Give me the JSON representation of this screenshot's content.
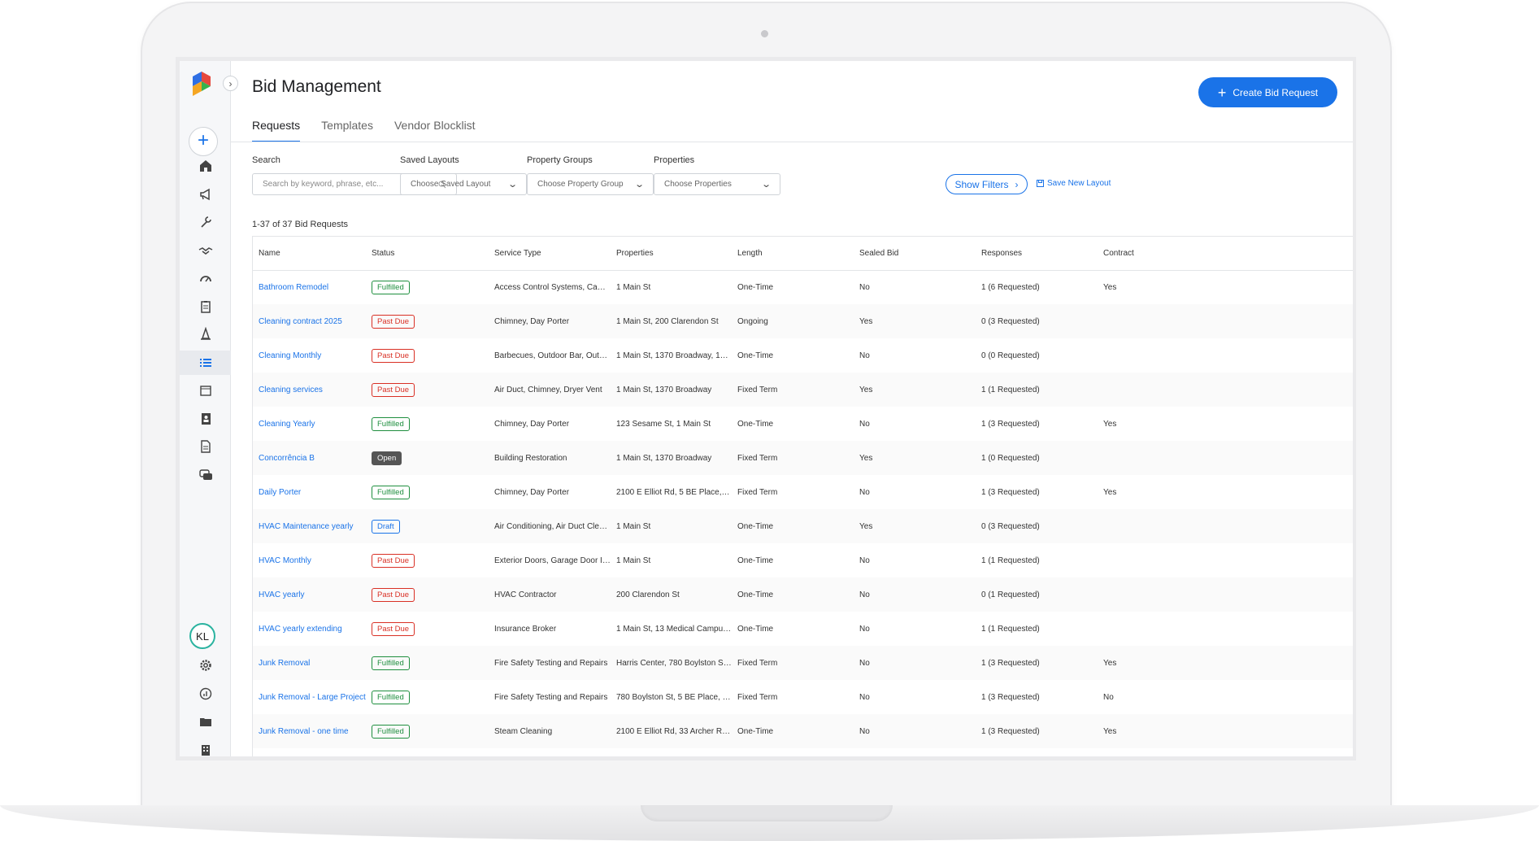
{
  "app": {
    "title": "Bid Management",
    "create_button": "Create Bid Request"
  },
  "tabs": [
    {
      "label": "Requests",
      "active": true
    },
    {
      "label": "Templates",
      "active": false
    },
    {
      "label": "Vendor Blocklist",
      "active": false
    }
  ],
  "sidebar": {
    "user_initials": "KL",
    "items": [
      {
        "icon": "home-icon"
      },
      {
        "icon": "megaphone-icon"
      },
      {
        "icon": "wrench-icon"
      },
      {
        "icon": "handshake-icon"
      },
      {
        "icon": "gauge-icon"
      },
      {
        "icon": "clipboard-icon"
      },
      {
        "icon": "cone-icon"
      },
      {
        "icon": "list-icon",
        "active": true
      },
      {
        "icon": "calendar-icon"
      },
      {
        "icon": "contacts-icon"
      },
      {
        "icon": "document-icon"
      },
      {
        "icon": "chat-icon"
      }
    ],
    "bottom_items": [
      {
        "icon": "gear-icon"
      },
      {
        "icon": "analytics-icon"
      },
      {
        "icon": "folder-icon"
      },
      {
        "icon": "building-icon"
      }
    ]
  },
  "filters": {
    "search_label": "Search",
    "search_placeholder": "Search by keyword, phrase, etc...",
    "saved_layouts_label": "Saved Layouts",
    "saved_layouts_value": "Choose Saved Layout",
    "property_groups_label": "Property Groups",
    "property_groups_value": "Choose Property Group",
    "properties_label": "Properties",
    "properties_value": "Choose Properties",
    "show_filters": "Show Filters",
    "save_new_layout": "Save New Layout"
  },
  "results_count": "1-37 of 37 Bid Requests",
  "table": {
    "columns": [
      "Name",
      "Status",
      "Service Type",
      "Properties",
      "Length",
      "Sealed Bid",
      "Responses",
      "Contract"
    ],
    "rows": [
      {
        "name": "Bathroom Remodel",
        "status": "Fulfilled",
        "service": "Access Control Systems, Cameras / ...",
        "properties": "1 Main St",
        "length": "One-Time",
        "sealed": "No",
        "responses": "1 (6 Requested)",
        "contract": "Yes"
      },
      {
        "name": "Cleaning contract 2025",
        "status": "Past Due",
        "service": "Chimney, Day Porter",
        "properties": "1 Main St, 200 Clarendon St",
        "length": "Ongoing",
        "sealed": "Yes",
        "responses": "0 (3 Requested)",
        "contract": ""
      },
      {
        "name": "Cleaning Monthly",
        "status": "Past Due",
        "service": "Barbecues, Outdoor Bar, Outdoor Fir...",
        "properties": "1 Main St, 1370 Broadway, 13 Medic...",
        "length": "One-Time",
        "sealed": "No",
        "responses": "0 (0 Requested)",
        "contract": ""
      },
      {
        "name": "Cleaning services",
        "status": "Past Due",
        "service": "Air Duct, Chimney, Dryer Vent",
        "properties": "1 Main St, 1370 Broadway",
        "length": "Fixed Term",
        "sealed": "Yes",
        "responses": "1 (1 Requested)",
        "contract": ""
      },
      {
        "name": "Cleaning Yearly",
        "status": "Fulfilled",
        "service": "Chimney, Day Porter",
        "properties": "123 Sesame St, 1 Main St",
        "length": "One-Time",
        "sealed": "No",
        "responses": "1 (3 Requested)",
        "contract": "Yes"
      },
      {
        "name": "Concorrência B",
        "status": "Open",
        "service": "Building Restoration",
        "properties": "1 Main St, 1370 Broadway",
        "length": "Fixed Term",
        "sealed": "Yes",
        "responses": "1 (0 Requested)",
        "contract": ""
      },
      {
        "name": "Daily Porter",
        "status": "Fulfilled",
        "service": "Chimney, Day Porter",
        "properties": "2100 E Elliot Rd, 5 BE Place, 1 Main ...",
        "length": "Fixed Term",
        "sealed": "No",
        "responses": "1 (3 Requested)",
        "contract": "Yes"
      },
      {
        "name": "HVAC Maintenance yearly",
        "status": "Draft",
        "service": "Air Conditioning, Air Duct Cleaning, ...",
        "properties": "1 Main St",
        "length": "One-Time",
        "sealed": "Yes",
        "responses": "0 (3 Requested)",
        "contract": ""
      },
      {
        "name": "HVAC Monthly",
        "status": "Past Due",
        "service": "Exterior Doors, Garage Door Installat...",
        "properties": "1 Main St",
        "length": "One-Time",
        "sealed": "No",
        "responses": "1 (1 Requested)",
        "contract": ""
      },
      {
        "name": "HVAC yearly",
        "status": "Past Due",
        "service": "HVAC Contractor",
        "properties": "200 Clarendon St",
        "length": "One-Time",
        "sealed": "No",
        "responses": "0 (1 Requested)",
        "contract": ""
      },
      {
        "name": "HVAC yearly extending",
        "status": "Past Due",
        "service": "Insurance Broker",
        "properties": "1 Main St, 13 Medical Campus Drive",
        "length": "One-Time",
        "sealed": "No",
        "responses": "1 (1 Requested)",
        "contract": ""
      },
      {
        "name": "Junk Removal",
        "status": "Fulfilled",
        "service": "Fire Safety Testing and Repairs",
        "properties": "Harris Center, 780 Boylston St, 5 BE ...",
        "length": "Fixed Term",
        "sealed": "No",
        "responses": "1 (3 Requested)",
        "contract": "Yes"
      },
      {
        "name": "Junk Removal - Large Project",
        "status": "Fulfilled",
        "service": "Fire Safety Testing and Repairs",
        "properties": "780 Boylston St, 5 BE Place, 123 Ses...",
        "length": "Fixed Term",
        "sealed": "No",
        "responses": "1 (3 Requested)",
        "contract": "No"
      },
      {
        "name": "Junk Removal - one time",
        "status": "Fulfilled",
        "service": "Steam Cleaning",
        "properties": "2100 E Elliot Rd, 33 Archer Rd, 200 C...",
        "length": "One-Time",
        "sealed": "No",
        "responses": "1 (3 Requested)",
        "contract": "Yes"
      }
    ]
  },
  "colors": {
    "accent": "#1a73e8",
    "fulfilled": "#1e8e3e",
    "past_due": "#d93025",
    "open": "#555555"
  }
}
